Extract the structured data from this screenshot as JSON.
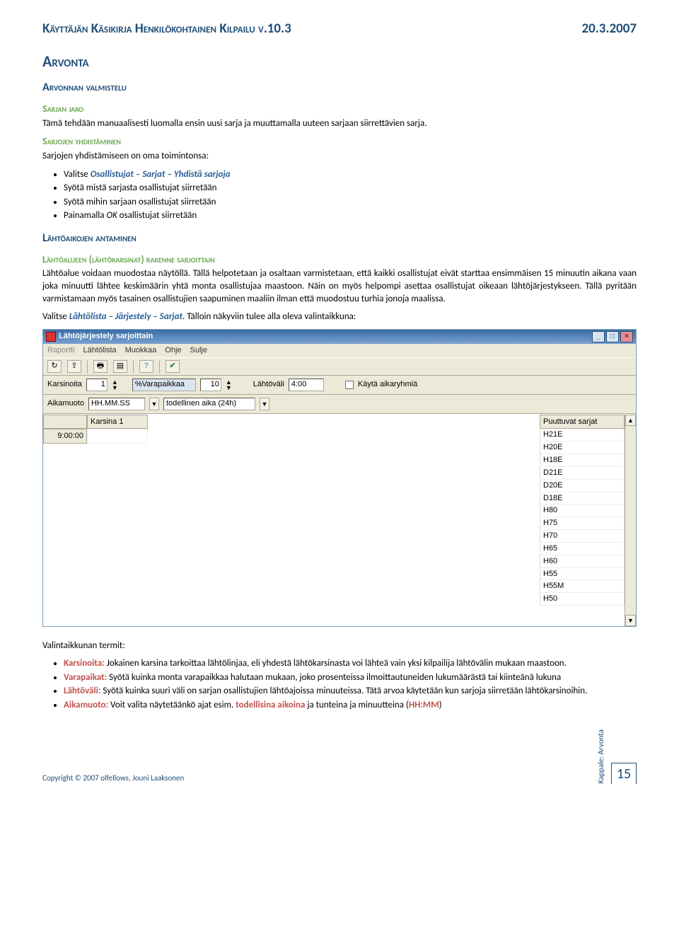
{
  "header": {
    "title": "Käyttäjän Käsikirja Henkilökohtainen Kilpailu v.10.3",
    "date": "20.3.2007"
  },
  "h1": "Arvonta",
  "h2a": "Arvonnan valmistelu",
  "sarjan_jako": {
    "title": "Sarjan jako",
    "text": "Tämä tehdään manuaalisesti luomalla ensin uusi sarja ja muuttamalla uuteen sarjaan siirrettävien sarja."
  },
  "sarjojen": {
    "title": "Sarjojen yhdistäminen",
    "intro": "Sarjojen yhdistämiseen on oma toimintonsa:",
    "b1_pre": "Valitse ",
    "b1_link": "Osallistujat – Sarjat – Yhdistä sarjoja",
    "b2": "Syötä mistä sarjasta osallistujat siirretään",
    "b3": "Syötä mihin sarjaan osallistujat siirretään",
    "b4_pre": "Painamalla ",
    "b4_ok": "OK",
    "b4_post": " osallistujat siirretään"
  },
  "h2b": "Lähtöaikojen antaminen",
  "lahtoalue": {
    "title": "Lähtöalueen (lähtökarsinat) rakenne sarjoittain",
    "p1": "Lähtöalue voidaan muodostaa näytöllä. Tällä helpotetaan ja osaltaan varmistetaan, että kaikki osallistujat eivät starttaa ensimmäisen 15 minuutin aikana vaan joka minuutti lähtee keskimäärin yhtä monta osallistujaa maastoon. Näin on myös helpompi asettaa osallistujat oikeaan lähtöjärjestykseen. Tällä pyritään varmistamaan myös tasainen osallistujien saapuminen maaliin ilman että muodostuu turhia jonoja maalissa.",
    "p2_pre": "Valitse ",
    "p2_link": "Lähtölista – Järjestely – Sarjat",
    "p2_post": ". Tälloin näkyviin tulee alla oleva valintaikkuna:"
  },
  "win": {
    "title": "Lähtöjärjestely sarjoittain",
    "menu": [
      "Raportti",
      "Lähtölista",
      "Muokkaa",
      "Ohje",
      "Sulje"
    ],
    "labels": {
      "karsinoita": "Karsinoita",
      "varapaikka": "%Varapaikkaa",
      "lahtovali": "Lähtöväli",
      "kayta": "Käytä aikaryhmiä",
      "aikamuoto": "Aikamuoto",
      "todellinen": "todellinen aika (24h)"
    },
    "vals": {
      "karsinoita": "1",
      "varapaikka": "10",
      "vali": "4:00",
      "aika_fmt": "HH.MM.SS"
    },
    "col_karsina": "Karsina 1",
    "first_time": "9:00:00",
    "right_header": "Puuttuvat sarjat",
    "sarjat": [
      "H21E",
      "H20E",
      "H18E",
      "D21E",
      "D20E",
      "D18E",
      "H80",
      "H75",
      "H70",
      "H65",
      "H60",
      "H55",
      "H55M",
      "H50"
    ]
  },
  "terms": {
    "intro": "Valintaikkunan termit:",
    "t1_label": "Karsinoita:",
    "t1": " Jokainen karsina tarkoittaa lähtölinjaa, eli yhdestä lähtökarsinasta voi lähteä vain yksi kilpailija lähtövälin mukaan maastoon.",
    "t2_label": "Varapaikat:",
    "t2": " Syötä kuinka monta varapaikkaa halutaan mukaan, joko prosenteissa ilmoittautuneiden lukumäärästä tai kiinteänä lukuna",
    "t3_label": "Lähtöväli:",
    "t3": " Syötä kuinka suuri väli on sarjan osallistujien lähtöajoissa minuuteissa. Tätä arvoa käytetään kun sarjoja siirretään lähtökarsinoihin.",
    "t4_label": "Aikamuoto:",
    "t4_a": " Voit valita näytetäänkö ajat esim. ",
    "t4_b": "todellisina aikoina",
    "t4_c": " ja tunteina ja minuutteina (",
    "t4_d": "HH:MM",
    "t4_e": ")"
  },
  "footer": {
    "copyright": "Copyright © 2007 olfellows, Jouni Laaksonen",
    "kappale_label": "Kappale:",
    "kappale": "Arvonta",
    "page": "15"
  }
}
